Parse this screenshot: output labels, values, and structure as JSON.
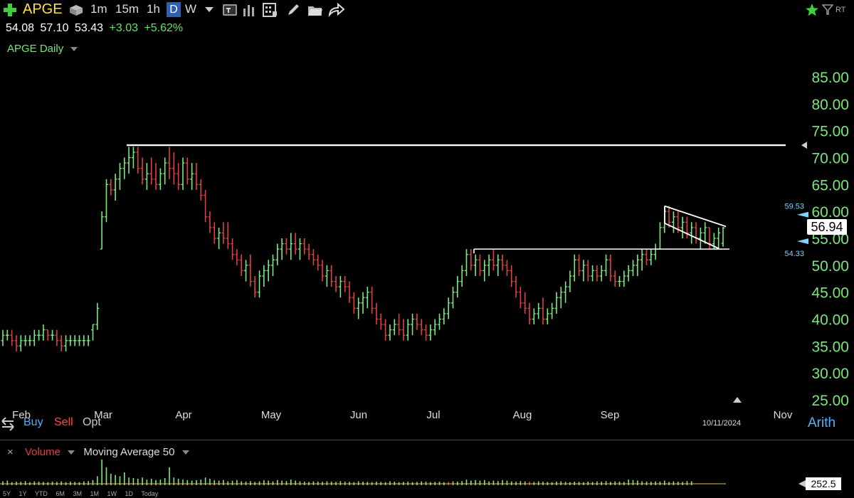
{
  "toolbar": {
    "symbol": "APGE",
    "intervals": [
      "1m",
      "15m",
      "1h"
    ],
    "active_interval": "D",
    "weekly_interval": "W",
    "rt_label": "RT"
  },
  "quote": {
    "open": "54.08",
    "high": "57.10",
    "low": "53.43",
    "change": "+3.03",
    "change_pct": "+5.62%"
  },
  "study_label": "APGE Daily",
  "trade": {
    "buy": "Buy",
    "sell": "Sell",
    "opt": "Opt"
  },
  "scale_mode": "Arith",
  "last_price_label": "56.94",
  "channel_labels": {
    "upper": "59.53",
    "lower": "54.33"
  },
  "date_label": "10/11/2024",
  "volume": {
    "label": "Volume",
    "ma_label": "Moving Average 50",
    "last_value": "252.5"
  },
  "range_buttons": [
    "5Y",
    "1Y",
    "YTD",
    "6M",
    "3M",
    "1M",
    "1W",
    "1D",
    "Today"
  ],
  "colors": {
    "up_bar": "#7ee87e",
    "axis_text": "#7ce57c",
    "background": "#000000",
    "volume_down": "#e04040",
    "annotation": "#ffffff"
  },
  "chart_data": {
    "type": "ohlc",
    "ylim": [
      25,
      85
    ],
    "y_ticks": [
      "85.00",
      "80.00",
      "75.00",
      "70.00",
      "65.00",
      "60.00",
      "55.00",
      "50.00",
      "45.00",
      "40.00",
      "35.00",
      "30.00",
      "25.00"
    ],
    "x_ticks": [
      "Feb",
      "Mar",
      "Apr",
      "May",
      "Jun",
      "Jul",
      "Aug",
      "Sep",
      "Nov"
    ],
    "trend_lines": [
      {
        "name": "resistance",
        "y": 72.3
      },
      {
        "name": "base",
        "y": 53.0
      }
    ],
    "flag_channel": {
      "upper": [
        61.0,
        57.2
      ],
      "lower": [
        57.8,
        53.1
      ]
    },
    "bars": [
      [
        36,
        38,
        35,
        37
      ],
      [
        37,
        38,
        36,
        37
      ],
      [
        37,
        38,
        35,
        36
      ],
      [
        36,
        37,
        34,
        35
      ],
      [
        35,
        37,
        34,
        36
      ],
      [
        36,
        37,
        35,
        36
      ],
      [
        36,
        37,
        35,
        36
      ],
      [
        36,
        38,
        35,
        37
      ],
      [
        37,
        38,
        36,
        37
      ],
      [
        37,
        39,
        36,
        38
      ],
      [
        38,
        38,
        36,
        37
      ],
      [
        37,
        38,
        36,
        37
      ],
      [
        37,
        38,
        35,
        36
      ],
      [
        36,
        37,
        34,
        35
      ],
      [
        35,
        37,
        34,
        36
      ],
      [
        36,
        37,
        35,
        36
      ],
      [
        36,
        37,
        35,
        36
      ],
      [
        36,
        37,
        35,
        36
      ],
      [
        36,
        37,
        35,
        36
      ],
      [
        36,
        37,
        35,
        36
      ],
      [
        38,
        39,
        36,
        39
      ],
      [
        39,
        43,
        38,
        42
      ],
      [
        53,
        60,
        53,
        59
      ],
      [
        59,
        66,
        58,
        65
      ],
      [
        65,
        66,
        63,
        64
      ],
      [
        64,
        67,
        62,
        66
      ],
      [
        66,
        69,
        64,
        68
      ],
      [
        68,
        70,
        66,
        69
      ],
      [
        69,
        72,
        67,
        70
      ],
      [
        70,
        72,
        68,
        71
      ],
      [
        71,
        72,
        67,
        68
      ],
      [
        68,
        70,
        65,
        66
      ],
      [
        66,
        69,
        64,
        67
      ],
      [
        67,
        70,
        65,
        66
      ],
      [
        66,
        69,
        64,
        65
      ],
      [
        65,
        68,
        64,
        67
      ],
      [
        67,
        70,
        65,
        69
      ],
      [
        69,
        72,
        66,
        68
      ],
      [
        68,
        71,
        65,
        67
      ],
      [
        67,
        69,
        64,
        65
      ],
      [
        65,
        70,
        64,
        69
      ],
      [
        69,
        70,
        65,
        66
      ],
      [
        66,
        69,
        64,
        67
      ],
      [
        67,
        69,
        64,
        65
      ],
      [
        65,
        66,
        62,
        63
      ],
      [
        63,
        64,
        58,
        59
      ],
      [
        59,
        60,
        56,
        57
      ],
      [
        57,
        58,
        54,
        55
      ],
      [
        55,
        57,
        53,
        56
      ],
      [
        56,
        58,
        54,
        55
      ],
      [
        55,
        58,
        53,
        54
      ],
      [
        54,
        55,
        51,
        52
      ],
      [
        52,
        53,
        50,
        51
      ],
      [
        51,
        52,
        48,
        49
      ],
      [
        49,
        51,
        47,
        50
      ],
      [
        50,
        52,
        46,
        47
      ],
      [
        47,
        48,
        44,
        45
      ],
      [
        45,
        49,
        44,
        48
      ],
      [
        48,
        50,
        46,
        49
      ],
      [
        49,
        51,
        47,
        50
      ],
      [
        50,
        52,
        48,
        51
      ],
      [
        51,
        54,
        50,
        53
      ],
      [
        53,
        55,
        51,
        54
      ],
      [
        54,
        55,
        52,
        53
      ],
      [
        53,
        56,
        51,
        54
      ],
      [
        54,
        56,
        52,
        53
      ],
      [
        53,
        55,
        51,
        54
      ],
      [
        54,
        55,
        52,
        53
      ],
      [
        53,
        54,
        51,
        52
      ],
      [
        52,
        53,
        50,
        51
      ],
      [
        51,
        52,
        49,
        50
      ],
      [
        50,
        51,
        47,
        48
      ],
      [
        48,
        50,
        46,
        49
      ],
      [
        49,
        50,
        46,
        47
      ],
      [
        47,
        48,
        45,
        46
      ],
      [
        46,
        48,
        44,
        47
      ],
      [
        47,
        48,
        45,
        46
      ],
      [
        46,
        47,
        43,
        44
      ],
      [
        44,
        45,
        41,
        42
      ],
      [
        42,
        44,
        40,
        43
      ],
      [
        43,
        45,
        41,
        44
      ],
      [
        44,
        46,
        42,
        45
      ],
      [
        45,
        46,
        41,
        42
      ],
      [
        42,
        43,
        39,
        40
      ],
      [
        40,
        41,
        38,
        39
      ],
      [
        39,
        40,
        36,
        37
      ],
      [
        37,
        39,
        36,
        38
      ],
      [
        38,
        40,
        37,
        39
      ],
      [
        39,
        41,
        37,
        38
      ],
      [
        38,
        40,
        36,
        37
      ],
      [
        37,
        40,
        36,
        39
      ],
      [
        39,
        41,
        37,
        40
      ],
      [
        40,
        41,
        38,
        39
      ],
      [
        39,
        40,
        37,
        38
      ],
      [
        38,
        39,
        36,
        37
      ],
      [
        37,
        39,
        36,
        38
      ],
      [
        38,
        40,
        37,
        39
      ],
      [
        39,
        41,
        38,
        40
      ],
      [
        40,
        42,
        39,
        41
      ],
      [
        41,
        44,
        40,
        43
      ],
      [
        43,
        46,
        42,
        45
      ],
      [
        45,
        48,
        44,
        47
      ],
      [
        47,
        50,
        46,
        49
      ],
      [
        49,
        53,
        48,
        52
      ],
      [
        52,
        53,
        49,
        50
      ],
      [
        50,
        52,
        48,
        51
      ],
      [
        51,
        52,
        48,
        49
      ],
      [
        49,
        51,
        47,
        50
      ],
      [
        50,
        52,
        48,
        51
      ],
      [
        51,
        53,
        49,
        50
      ],
      [
        50,
        52,
        48,
        51
      ],
      [
        51,
        52,
        49,
        50
      ],
      [
        50,
        51,
        48,
        49
      ],
      [
        49,
        50,
        46,
        47
      ],
      [
        47,
        48,
        44,
        45
      ],
      [
        45,
        46,
        42,
        43
      ],
      [
        43,
        45,
        41,
        42
      ],
      [
        42,
        43,
        39,
        40
      ],
      [
        40,
        42,
        39,
        41
      ],
      [
        41,
        43,
        40,
        42
      ],
      [
        42,
        44,
        39,
        40
      ],
      [
        40,
        42,
        39,
        41
      ],
      [
        41,
        43,
        40,
        42
      ],
      [
        42,
        45,
        41,
        44
      ],
      [
        44,
        46,
        42,
        45
      ],
      [
        45,
        47,
        43,
        46
      ],
      [
        46,
        49,
        45,
        48
      ],
      [
        48,
        52,
        47,
        51
      ],
      [
        51,
        52,
        48,
        49
      ],
      [
        49,
        51,
        47,
        50
      ],
      [
        50,
        51,
        47,
        48
      ],
      [
        48,
        50,
        47,
        49
      ],
      [
        49,
        50,
        47,
        48
      ],
      [
        48,
        50,
        47,
        49
      ],
      [
        49,
        52,
        48,
        51
      ],
      [
        51,
        52,
        47,
        48
      ],
      [
        48,
        49,
        46,
        47
      ],
      [
        47,
        48,
        46,
        47
      ],
      [
        47,
        49,
        46,
        48
      ],
      [
        48,
        50,
        47,
        49
      ],
      [
        49,
        51,
        48,
        50
      ],
      [
        50,
        52,
        48,
        51
      ],
      [
        51,
        53,
        49,
        52
      ],
      [
        52,
        53,
        50,
        51
      ],
      [
        51,
        53,
        50,
        52
      ],
      [
        52,
        54,
        51,
        53
      ],
      [
        53,
        58,
        53,
        57
      ],
      [
        57,
        61,
        56,
        60
      ],
      [
        60,
        61,
        57,
        58
      ],
      [
        58,
        60,
        56,
        59
      ],
      [
        59,
        60,
        56,
        57
      ],
      [
        57,
        59,
        55,
        58
      ],
      [
        58,
        59,
        55,
        56
      ],
      [
        56,
        58,
        54,
        57
      ],
      [
        57,
        58,
        54,
        55
      ],
      [
        55,
        57,
        53,
        56
      ],
      [
        56,
        58,
        54,
        57
      ],
      [
        57,
        57,
        53,
        54
      ],
      [
        54,
        56,
        53,
        55
      ],
      [
        55,
        57,
        53,
        56
      ],
      [
        54.08,
        57.1,
        53.43,
        56.94
      ]
    ],
    "volume_ratio": [
      0.15,
      0.18,
      0.12,
      0.14,
      0.13,
      0.16,
      0.12,
      0.15,
      0.14,
      0.13,
      0.12,
      0.14,
      0.13,
      0.15,
      0.12,
      0.14,
      0.13,
      0.12,
      0.15,
      0.16,
      0.2,
      0.35,
      1.0,
      0.7,
      0.45,
      0.4,
      0.35,
      0.5,
      0.3,
      0.28,
      0.25,
      0.3,
      0.22,
      0.25,
      0.2,
      0.22,
      0.28,
      0.7,
      0.3,
      0.25,
      0.22,
      0.2,
      0.18,
      0.2,
      0.22,
      0.3,
      0.25,
      0.2,
      0.18,
      0.2,
      0.15,
      0.18,
      0.2,
      0.15,
      0.14,
      0.16,
      0.13,
      0.15,
      0.2,
      0.18,
      0.15,
      0.2,
      0.18,
      0.16,
      0.22,
      0.18,
      0.15,
      0.14,
      0.13,
      0.15,
      0.14,
      0.13,
      0.15,
      0.14,
      0.13,
      0.16,
      0.14,
      0.13,
      0.12,
      0.15,
      0.14,
      0.13,
      0.12,
      0.14,
      0.13,
      0.12,
      0.15,
      0.14,
      0.12,
      0.13,
      0.14,
      0.12,
      0.13,
      0.15,
      0.14,
      0.12,
      0.13,
      0.14,
      0.12,
      0.13,
      0.15,
      0.14,
      0.16,
      0.22,
      0.18,
      0.2,
      0.18,
      0.2,
      0.15,
      0.18,
      0.16,
      0.2,
      0.18,
      0.15,
      0.14,
      0.16,
      0.15,
      0.14,
      0.13,
      0.15,
      0.14,
      0.13,
      0.12,
      0.14,
      0.15,
      0.13,
      0.12,
      0.14,
      0.13,
      0.12,
      0.14,
      0.13,
      0.15,
      0.14,
      0.16,
      0.13,
      0.15,
      0.14,
      0.13,
      0.22,
      0.2,
      0.18,
      0.15,
      0.14,
      0.13,
      0.15,
      0.14,
      0.18,
      0.13,
      0.15,
      0.14,
      0.13,
      0.16,
      0.15
    ],
    "volume_down_index": [
      99,
      117
    ]
  }
}
